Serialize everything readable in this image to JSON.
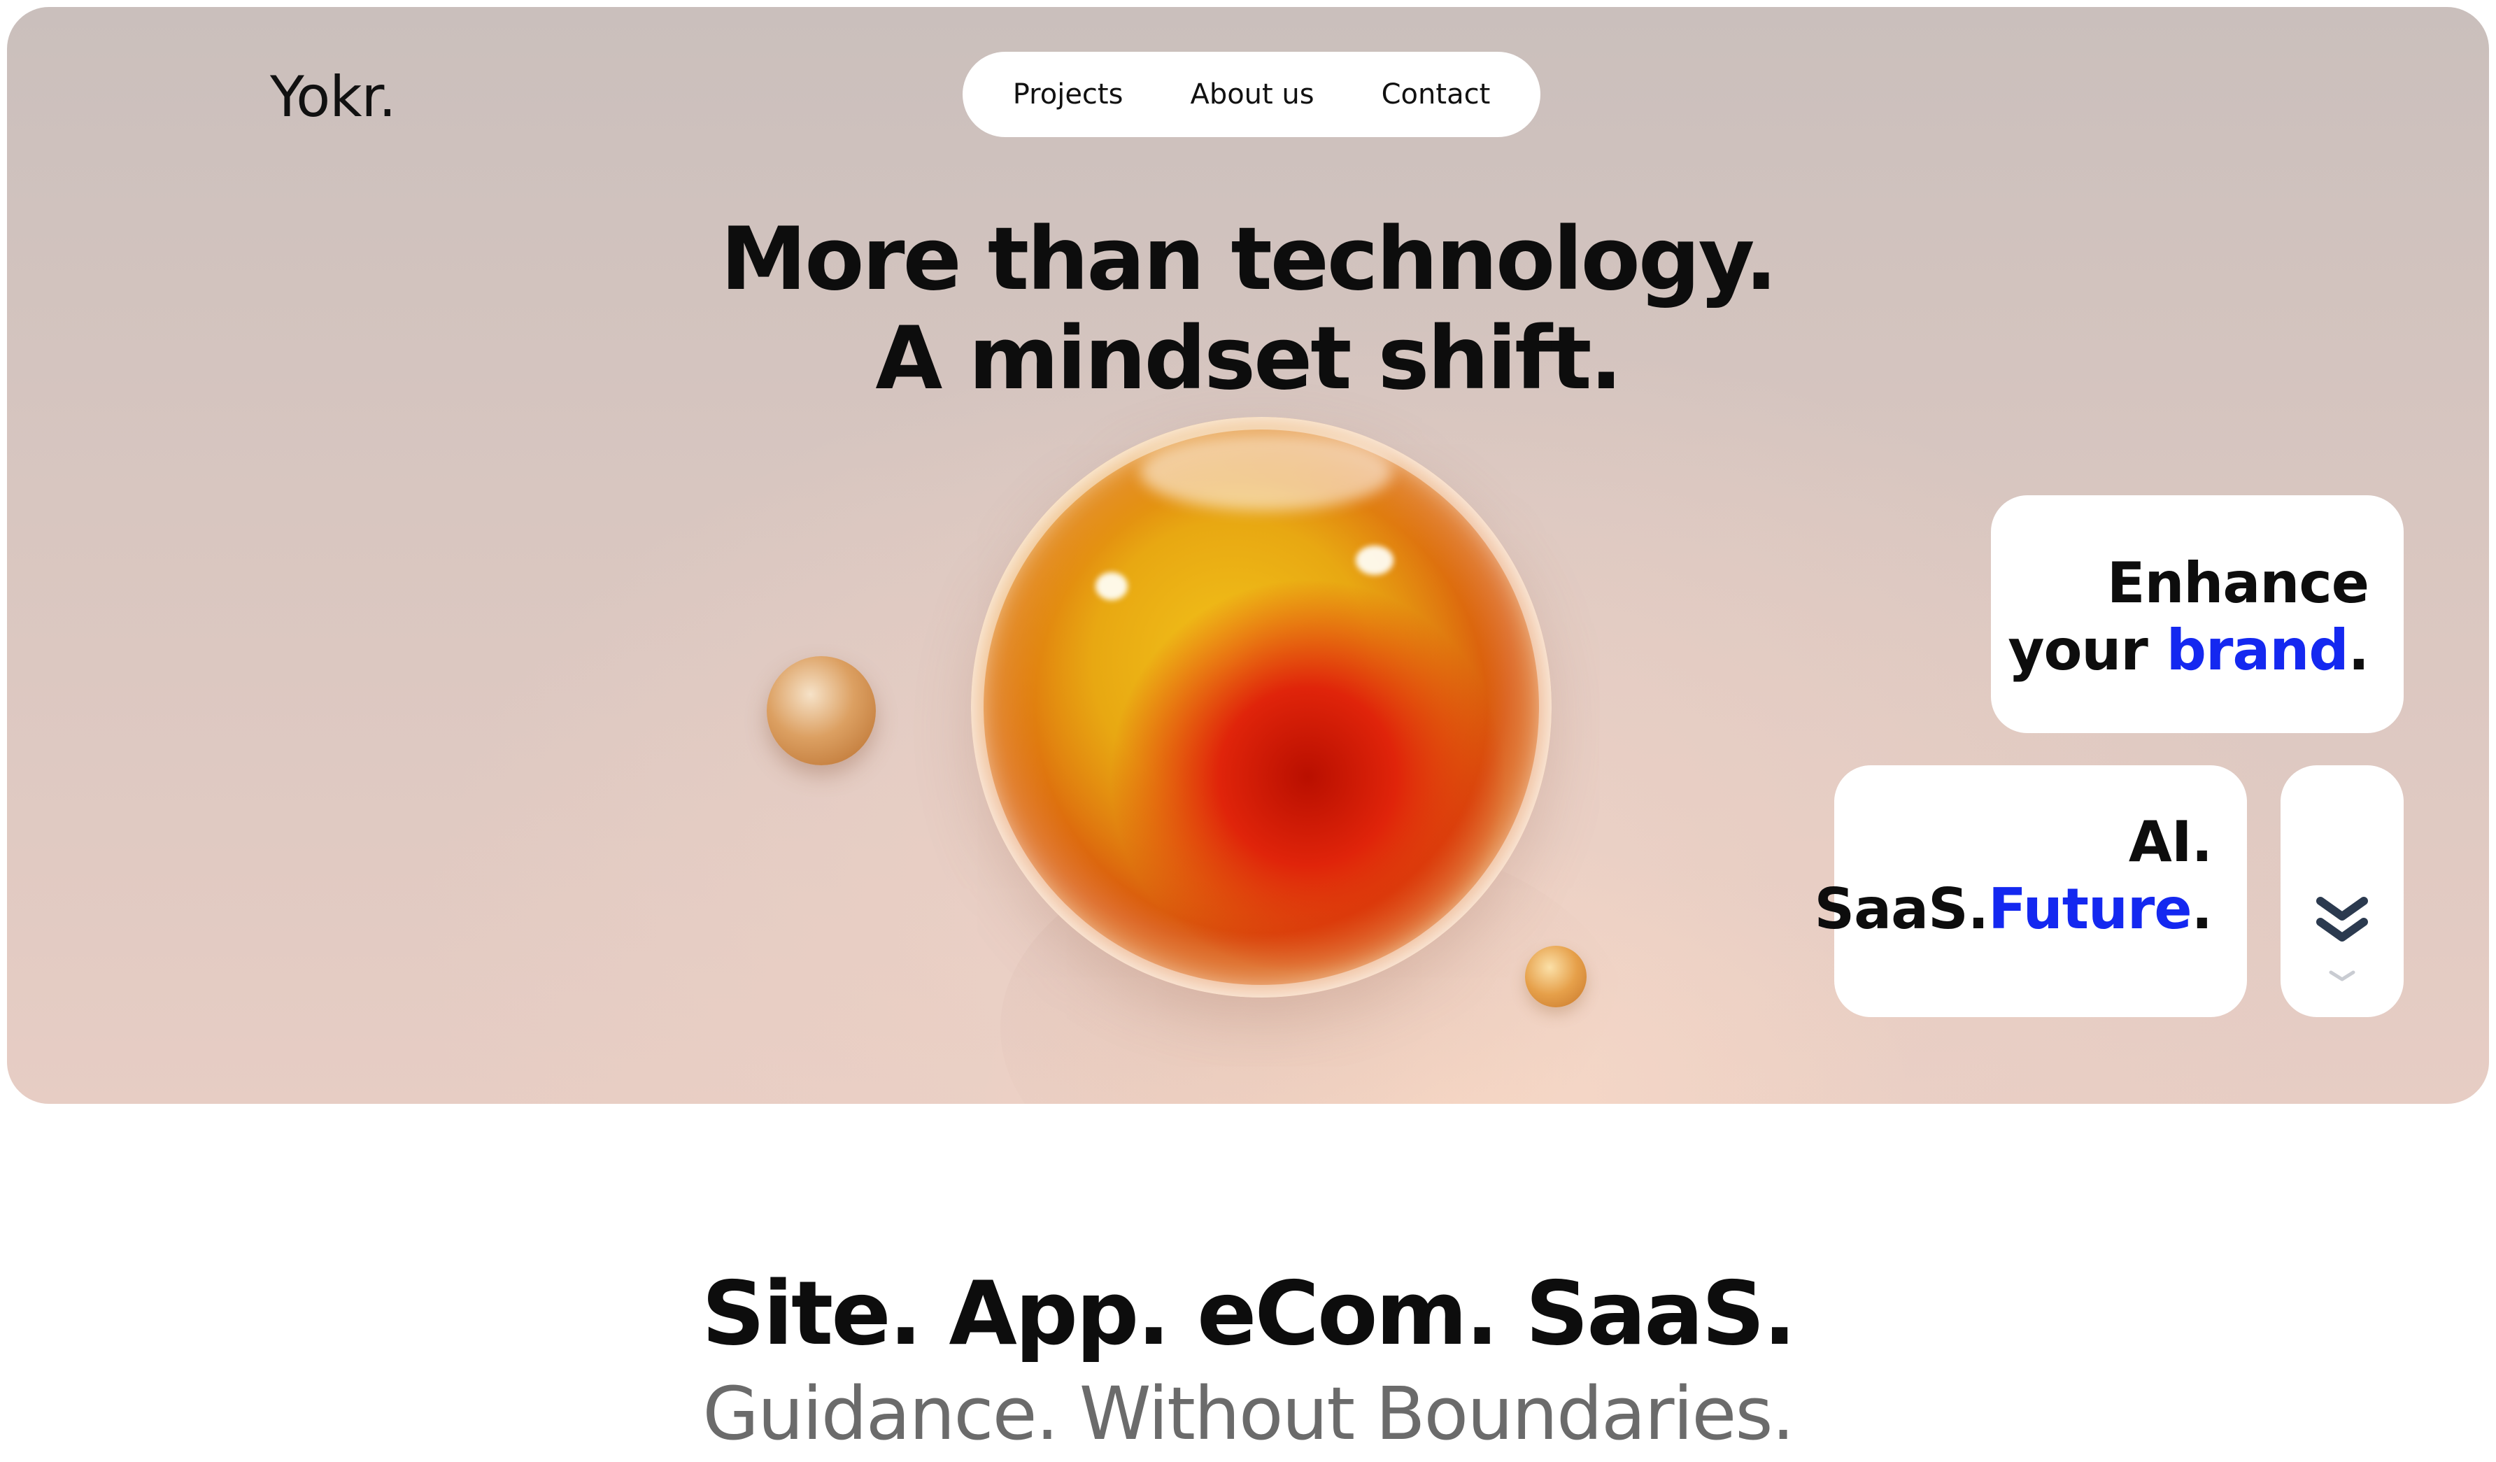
{
  "brand": {
    "logo": "Yokr."
  },
  "nav": {
    "items": [
      {
        "label": "Projects"
      },
      {
        "label": "About us"
      },
      {
        "label": "Contact"
      }
    ]
  },
  "hero": {
    "headline_line1": "More than technology.",
    "headline_line2": "A mindset shift."
  },
  "cards": {
    "brand": {
      "line1": "Enhance",
      "line2_prefix": "your ",
      "line2_accent": "brand",
      "line2_suffix": "."
    },
    "ai": {
      "line1": "AI.",
      "line2_prefix": "SaaS.",
      "line2_accent": "Future",
      "line2_suffix": "."
    },
    "scroll": {
      "icon": "double-chevron-down-icon"
    }
  },
  "section": {
    "title": "Site. App. eCom. SaaS.",
    "subtitle": "Guidance. Without Boundaries."
  },
  "colors": {
    "accent": "#1428f0",
    "text": "#0d0d0d",
    "muted": "#6b6b6b",
    "chevron": "#2b3a4f"
  }
}
